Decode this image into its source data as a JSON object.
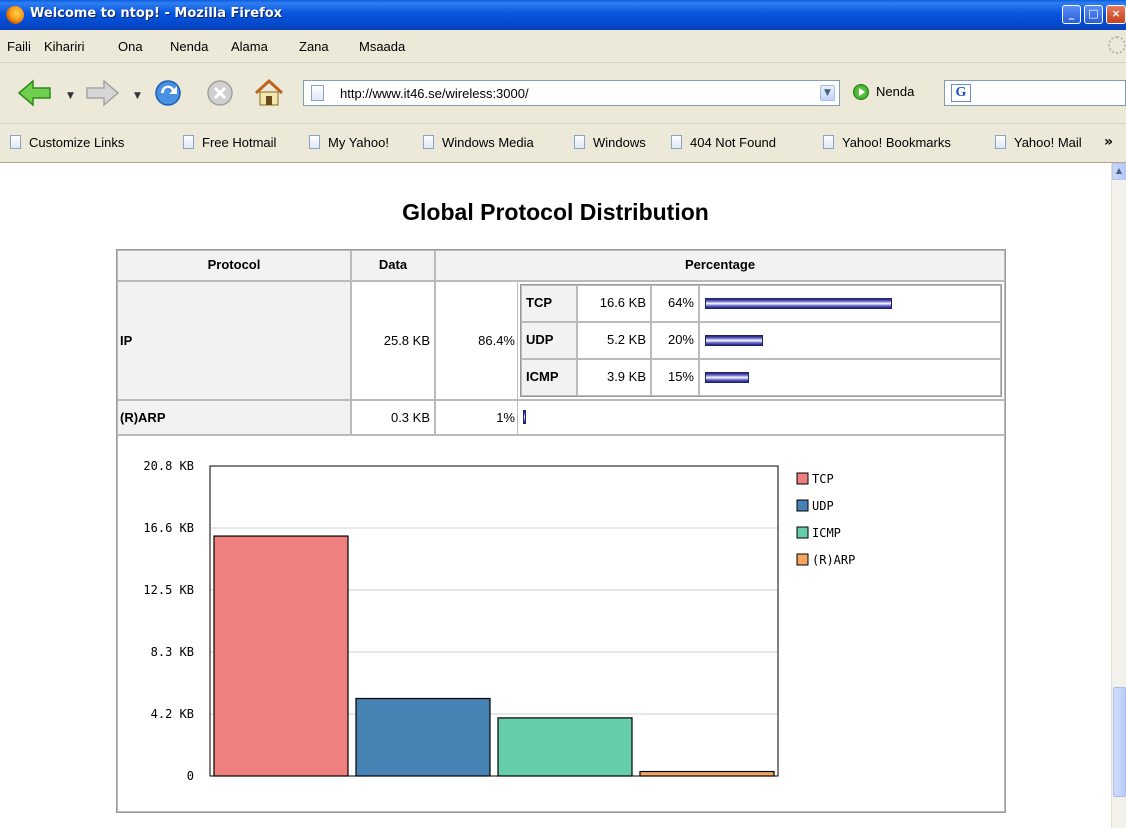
{
  "window": {
    "title": "Welcome to ntop! - Mozilla Firefox"
  },
  "menu": [
    "Faili",
    "Kihariri",
    "Ona",
    "Nenda",
    "Alama",
    "Zana",
    "Msaada"
  ],
  "nav": {
    "url": "http://www.it46.se/wireless:3000/",
    "go_label": "Nenda",
    "search_value": ""
  },
  "bookmarks": [
    "Customize Links",
    "Free Hotmail",
    "My Yahoo!",
    "Windows Media",
    "Windows",
    "404 Not Found",
    "Yahoo! Bookmarks",
    "Yahoo! Mail"
  ],
  "page": {
    "title": "Global Protocol Distribution",
    "headers": {
      "protocol": "Protocol",
      "data": "Data",
      "percentage": "Percentage"
    },
    "rows": [
      {
        "protocol": "IP",
        "data": "25.8 KB",
        "percent": "86.4%",
        "sub": [
          {
            "name": "TCP",
            "data": "16.6 KB",
            "percent": "64%",
            "fraction": 0.64
          },
          {
            "name": "UDP",
            "data": "5.2 KB",
            "percent": "20%",
            "fraction": 0.2
          },
          {
            "name": "ICMP",
            "data": "3.9 KB",
            "percent": "15%",
            "fraction": 0.15
          }
        ]
      },
      {
        "protocol": "(R)ARP",
        "data": "0.3 KB",
        "percent": "1%",
        "fraction": 0.01
      }
    ]
  },
  "chart_data": {
    "type": "bar",
    "categories": [
      "TCP",
      "UDP",
      "ICMP",
      "(R)ARP"
    ],
    "values": [
      16.1,
      5.2,
      3.9,
      0.3
    ],
    "colors": [
      "#f08080",
      "#4682b4",
      "#66cdaa",
      "#f4a460"
    ],
    "ytick_labels": [
      "0",
      "4.2 KB",
      "8.3 KB",
      "12.5 KB",
      "16.6 KB",
      "20.8 KB"
    ],
    "ylim": [
      0,
      20.8
    ],
    "grid": true,
    "legend": "right"
  }
}
